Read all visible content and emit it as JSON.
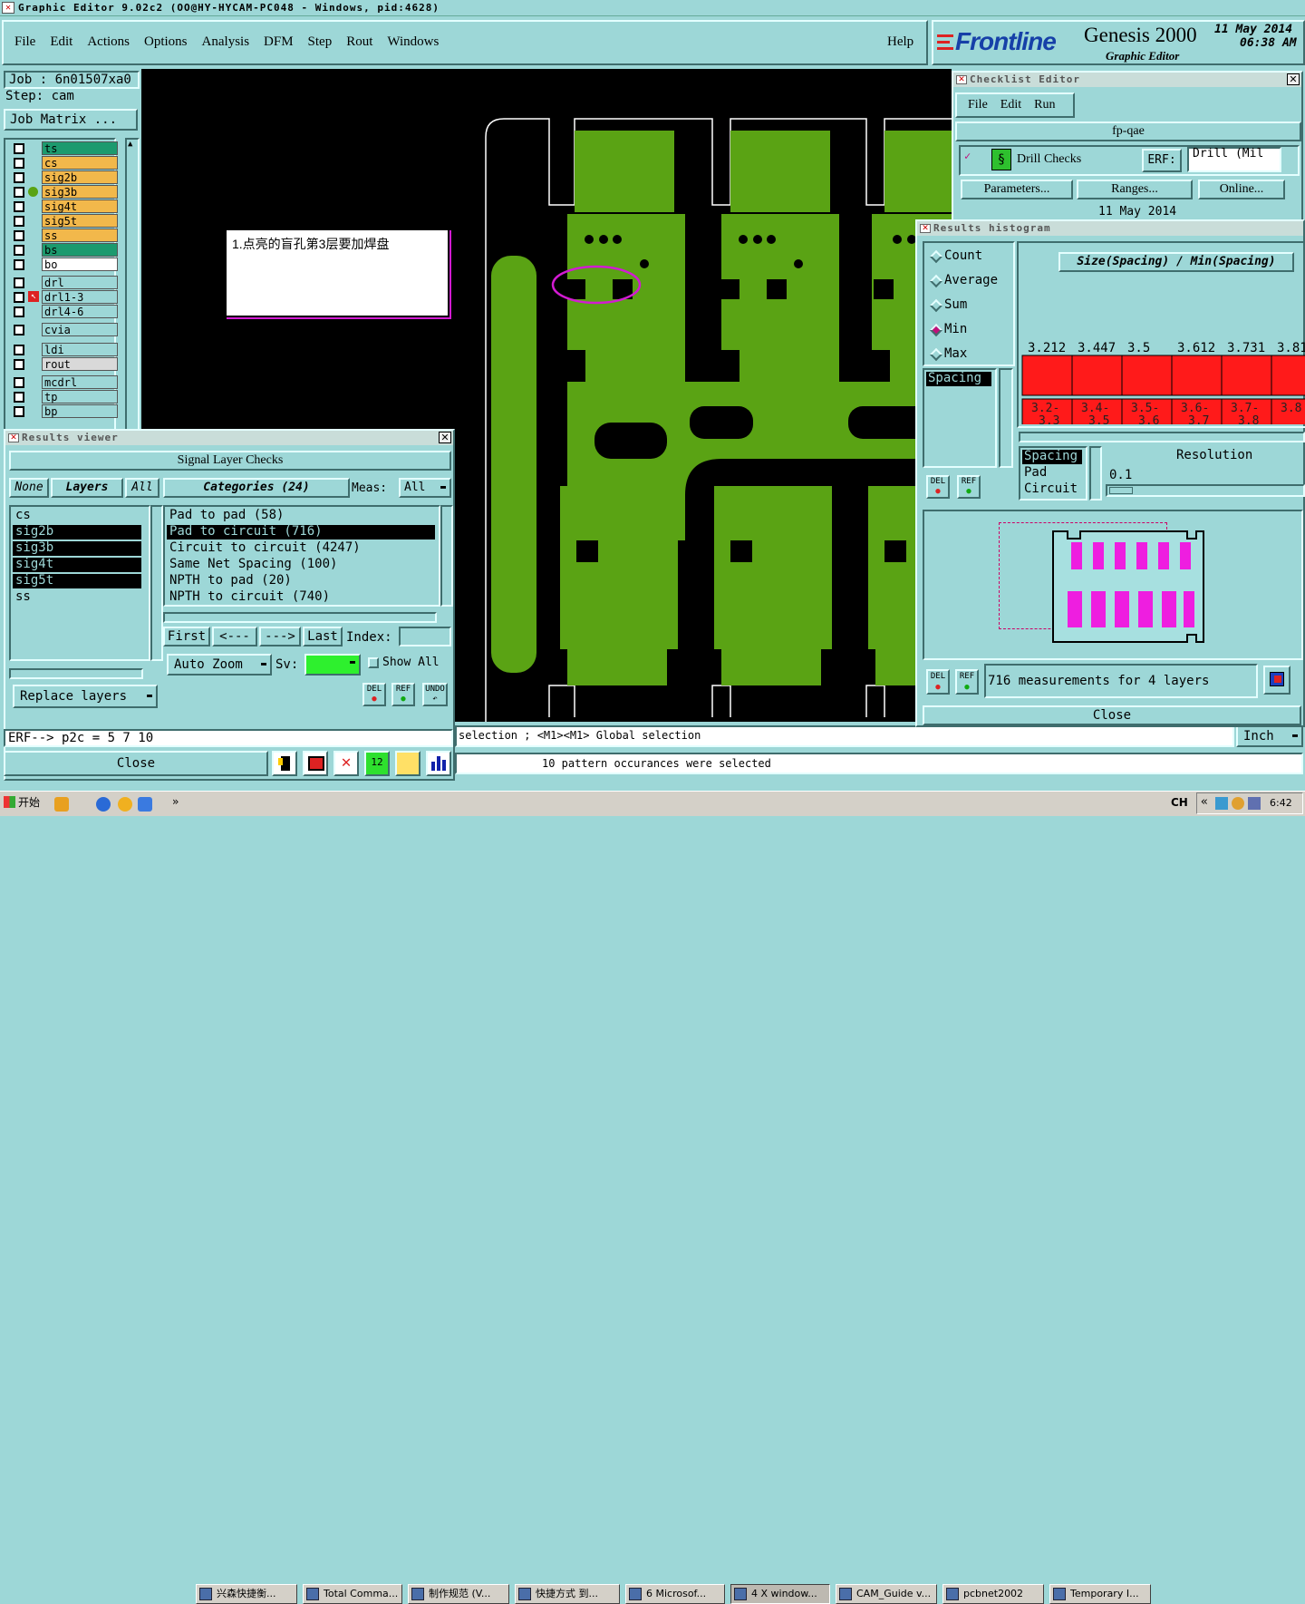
{
  "window": {
    "title": "Graphic Editor 9.02c2 (OO@HY-HYCAM-PC048 - Windows, pid:4628)"
  },
  "menu": [
    "File",
    "Edit",
    "Actions",
    "Options",
    "Analysis",
    "DFM",
    "Step",
    "Rout",
    "Windows"
  ],
  "help_label": "Help",
  "brand": {
    "logo": "Frontline",
    "product": "Genesis 2000",
    "subtitle": "Graphic Editor",
    "date": "11 May 2014",
    "time": "06:38 AM"
  },
  "job": {
    "job_label": "Job : 6n01507xa0",
    "step_label": "Step: cam",
    "matrix_button": "Job Matrix ..."
  },
  "layers": [
    {
      "name": "ts",
      "color": "#1c9a6e"
    },
    {
      "name": "cs",
      "color": "#f2b84b"
    },
    {
      "name": "sig2b",
      "color": "#f2b84b"
    },
    {
      "name": "sig3b",
      "color": "#f2b84b"
    },
    {
      "name": "sig4t",
      "color": "#f2b84b"
    },
    {
      "name": "sig5t",
      "color": "#f2b84b"
    },
    {
      "name": "ss",
      "color": "#f2b84b"
    },
    {
      "name": "bs",
      "color": "#1c9a6e"
    },
    {
      "name": "bo",
      "color": "#ffffff"
    },
    {
      "name": "drl",
      "color": "#9dd7d7"
    },
    {
      "name": "drl1-3",
      "color": "#9dd7d7"
    },
    {
      "name": "drl4-6",
      "color": "#9dd7d7"
    },
    {
      "name": "cvia",
      "color": "#9dd7d7"
    },
    {
      "name": "ldi",
      "color": "#9dd7d7"
    },
    {
      "name": "rout",
      "color": "#d9d9d9"
    },
    {
      "name": "mcdrl",
      "color": "#9dd7d7"
    },
    {
      "name": "tp",
      "color": "#9dd7d7"
    },
    {
      "name": "bp",
      "color": "#9dd7d7"
    }
  ],
  "annotation": "1.点亮的盲孔第3层要加焊盘",
  "results_viewer": {
    "title": "Results viewer",
    "header": "Signal Layer Checks",
    "none_label": "None",
    "layers_label": "Layers",
    "all_label": "All",
    "categories_label": "Categories (24)",
    "meas_label": "Meas:",
    "meas_value": "All",
    "layer_list": [
      {
        "name": "cs",
        "selected": false
      },
      {
        "name": "sig2b",
        "selected": true
      },
      {
        "name": "sig3b",
        "selected": true
      },
      {
        "name": "sig4t",
        "selected": true
      },
      {
        "name": "sig5t",
        "selected": true
      },
      {
        "name": "ss",
        "selected": false
      }
    ],
    "categories": [
      {
        "text": "Pad to pad (58)",
        "selected": false
      },
      {
        "text": "Pad to circuit (716)",
        "selected": true
      },
      {
        "text": "Circuit to circuit (4247)",
        "selected": false
      },
      {
        "text": "Same Net Spacing (100)",
        "selected": false
      },
      {
        "text": "NPTH to pad (20)",
        "selected": false
      },
      {
        "text": "NPTH to circuit (740)",
        "selected": false
      }
    ],
    "nav": {
      "first": "First",
      "prev": "<---",
      "next": "--->",
      "last": "Last",
      "index": "Index:"
    },
    "auto_zoom": "Auto Zoom",
    "sv": "Sv:",
    "show_all": "Show All",
    "replace_layers": "Replace layers",
    "erf_text": "ERF--> p2c = 5 7 10",
    "close": "Close",
    "del": "DEL",
    "ref": "REF",
    "undo": "UNDO"
  },
  "checklist": {
    "title": "Checklist Editor",
    "menu": [
      "File",
      "Edit",
      "Run"
    ],
    "name": "fp-qae",
    "check_name": "Drill Checks",
    "erf_label": "ERF:",
    "erf_value": "Drill (Mil",
    "parameters": "Parameters...",
    "ranges": "Ranges...",
    "online": "Online...",
    "date": "11 May 2014"
  },
  "histogram": {
    "title": "Results histogram",
    "options": [
      {
        "label": "Count",
        "selected": false
      },
      {
        "label": "Average",
        "selected": false
      },
      {
        "label": "Sum",
        "selected": false
      },
      {
        "label": "Min",
        "selected": true
      },
      {
        "label": "Max",
        "selected": false
      }
    ],
    "chart_title": "Size(Spacing) / Min(Spacing)",
    "values": [
      "3.212",
      "3.447",
      "3.5",
      "3.612",
      "3.731",
      "3.81"
    ],
    "bins": [
      [
        "3.2-",
        "3.3"
      ],
      [
        "3.4-",
        "3.5"
      ],
      [
        "3.5-",
        "3.6"
      ],
      [
        "3.6-",
        "3.7"
      ],
      [
        "3.7-",
        "3.8"
      ],
      [
        "3.8",
        ""
      ]
    ],
    "list_top": [
      "Spacing"
    ],
    "list_bottom": [
      "Spacing",
      "Pad",
      "Circuit"
    ],
    "resolution_label": "Resolution",
    "resolution_value": "0.1",
    "measurements": "716 measurements for 4 layers",
    "close": "Close"
  },
  "status": {
    "line1": "selection ; <M1><M1> Global selection",
    "line2": "10 pattern occurances were selected",
    "units": "Inch"
  },
  "taskbar": {
    "start": "开始",
    "items": [
      "兴森快捷衡...",
      "Total Comma...",
      "制作规范 (V...",
      "快捷方式 到...",
      "6 Microsof...",
      "4 X window...",
      "CAM_Guide v...",
      "pcbnet2002",
      "Temporary I..."
    ],
    "lang": "CH",
    "clock": "6:42"
  }
}
